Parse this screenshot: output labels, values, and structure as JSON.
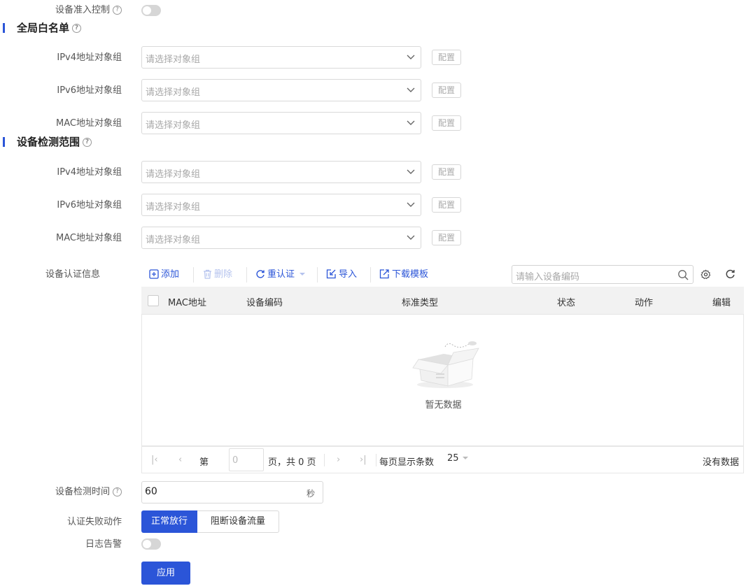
{
  "device_access": {
    "label": "设备准入控制",
    "help": "?",
    "enabled": false
  },
  "global_whitelist": {
    "title": "全局白名单",
    "help": "?",
    "rows": [
      {
        "label": "IPv4地址对象组",
        "placeholder": "请选择对象组",
        "config": "配置"
      },
      {
        "label": "IPv6地址对象组",
        "placeholder": "请选择对象组",
        "config": "配置"
      },
      {
        "label": "MAC地址对象组",
        "placeholder": "请选择对象组",
        "config": "配置"
      }
    ]
  },
  "detect_range": {
    "title": "设备检测范围",
    "help": "?",
    "rows": [
      {
        "label": "IPv4地址对象组",
        "placeholder": "请选择对象组",
        "config": "配置"
      },
      {
        "label": "IPv6地址对象组",
        "placeholder": "请选择对象组",
        "config": "配置"
      },
      {
        "label": "MAC地址对象组",
        "placeholder": "请选择对象组",
        "config": "配置"
      }
    ]
  },
  "auth_info": {
    "label": "设备认证信息",
    "toolbar": {
      "add": "添加",
      "delete": "删除",
      "reauth": "重认证",
      "import": "导入",
      "download": "下载模板"
    },
    "search_placeholder": "请输入设备编码",
    "columns": [
      "MAC地址",
      "设备编码",
      "标准类型",
      "状态",
      "动作",
      "编辑"
    ],
    "empty_text": "暂无数据",
    "pager": {
      "page_prefix": "第",
      "page_value": "0",
      "page_suffix": "页，共 0 页",
      "per_page_label": "每页显示条数",
      "per_page": "25",
      "status": "没有数据"
    }
  },
  "detect_time": {
    "label": "设备检测时间",
    "help": "?",
    "value": "60",
    "unit": "秒"
  },
  "fail_action": {
    "label": "认证失败动作",
    "options": [
      "正常放行",
      "阻断设备流量"
    ],
    "selected": "正常放行"
  },
  "log_alarm": {
    "label": "日志告警",
    "enabled": false
  },
  "apply_label": "应用",
  "colors": {
    "accent": "#2b55d8"
  }
}
